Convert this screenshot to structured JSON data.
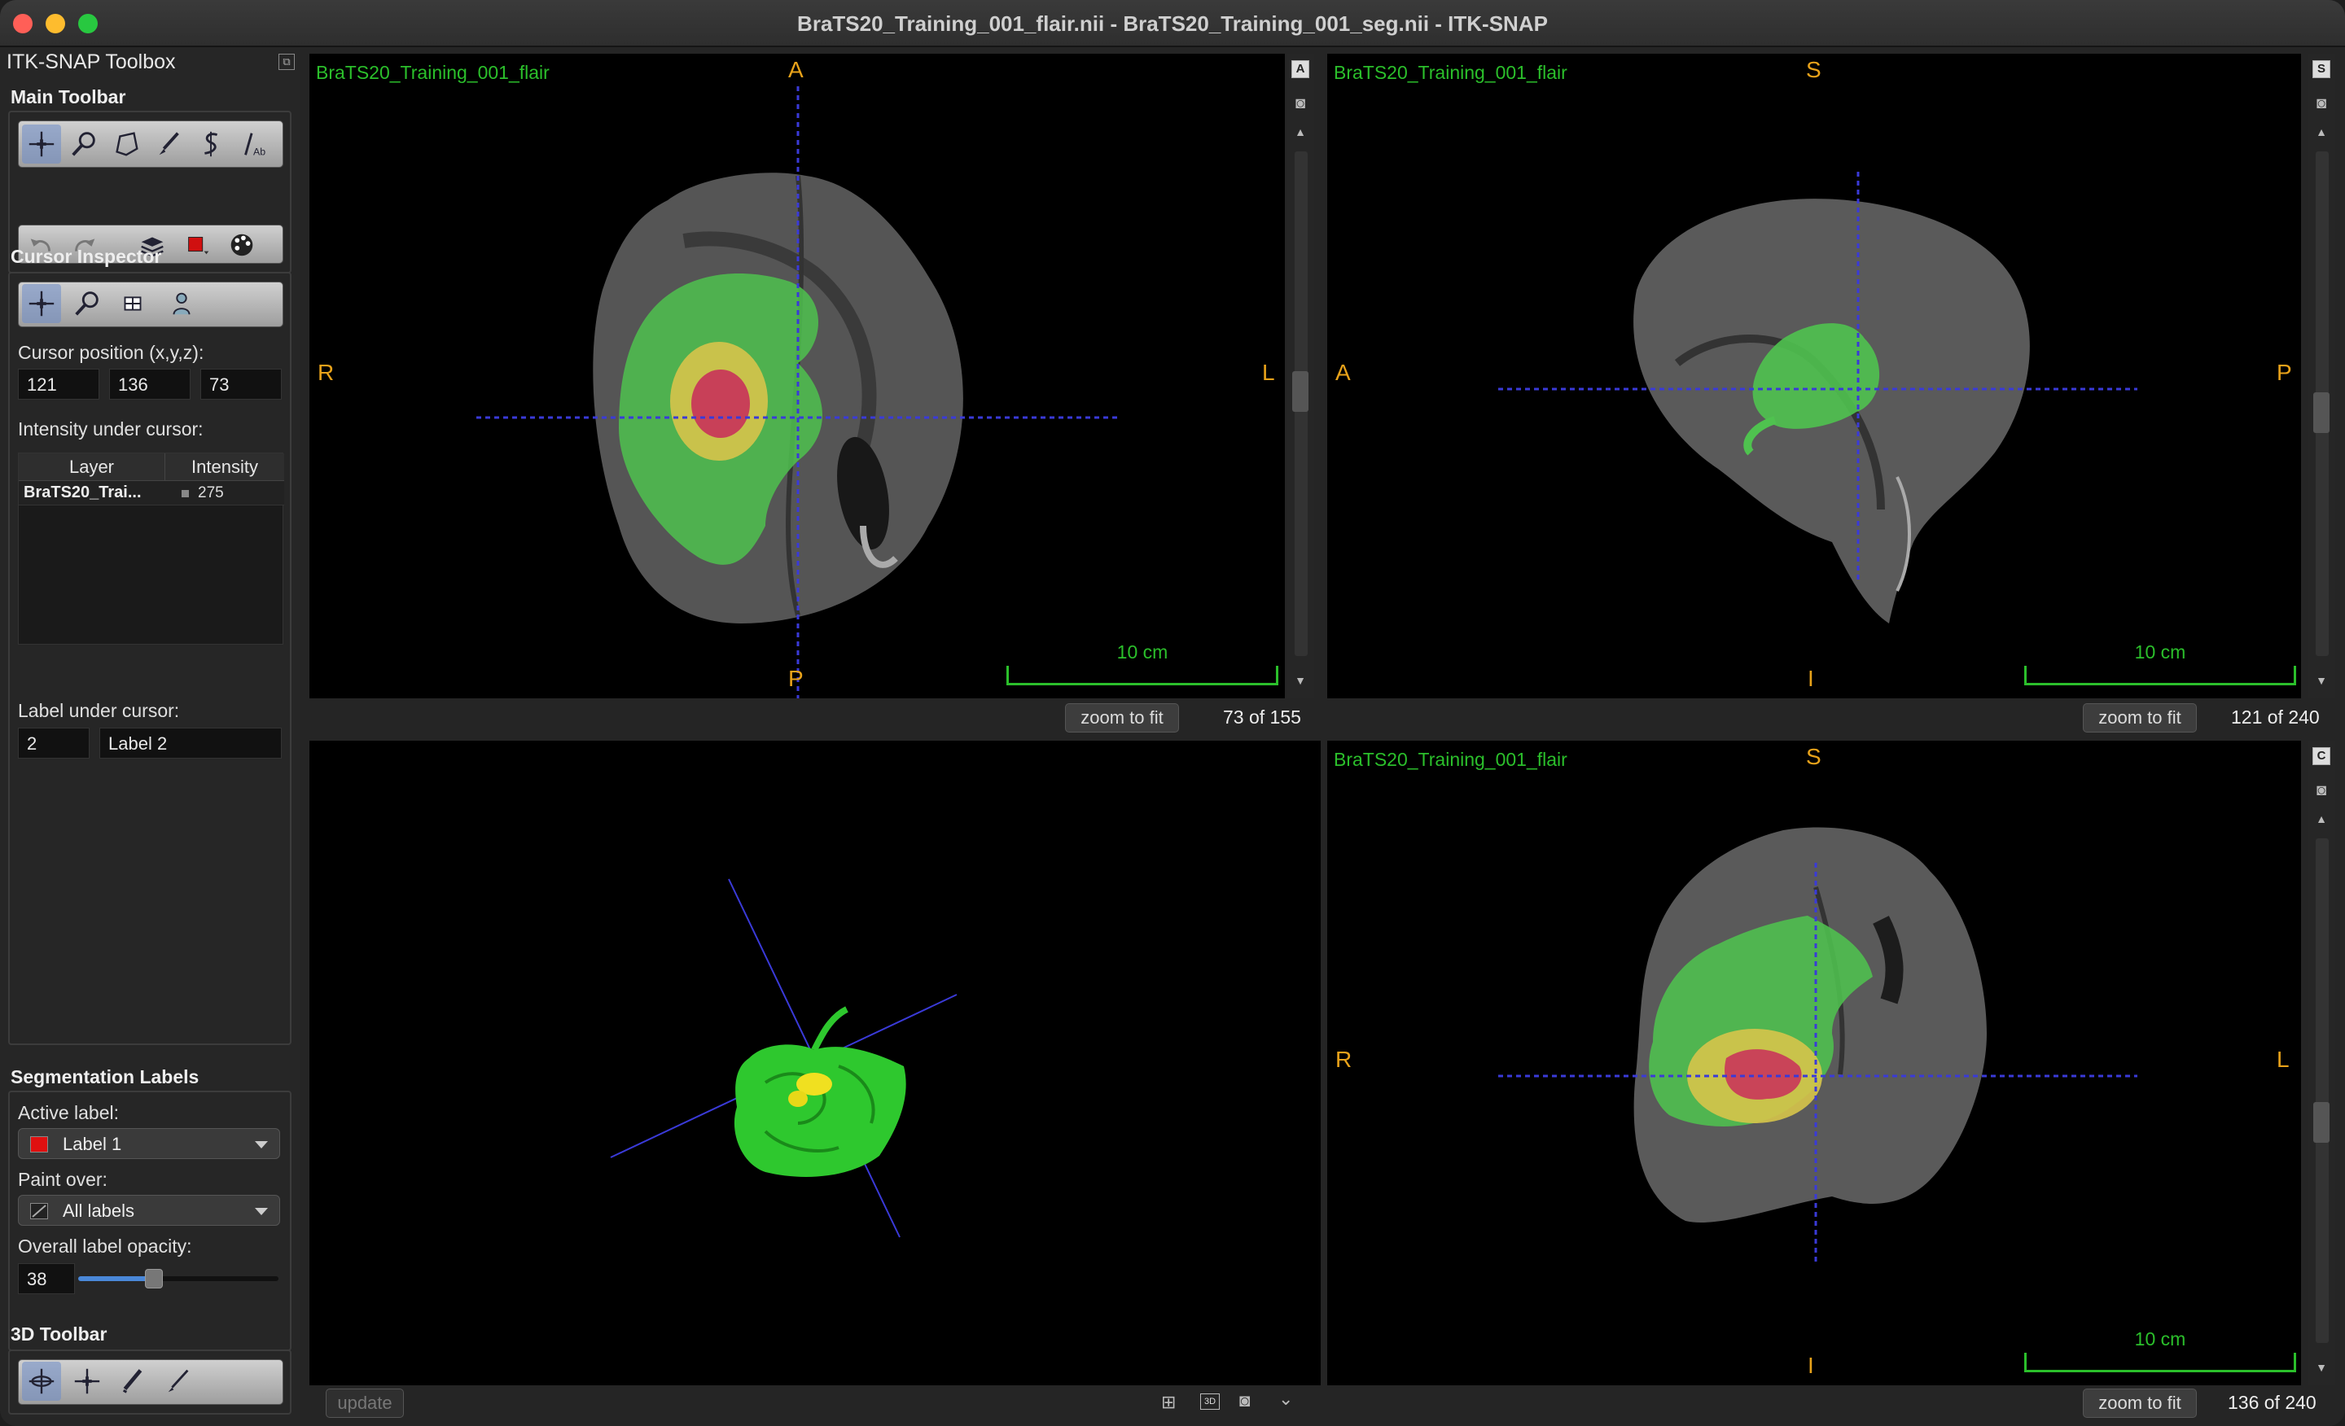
{
  "window": {
    "title": "BraTS20_Training_001_flair.nii - BraTS20_Training_001_seg.nii - ITK-SNAP"
  },
  "toolbox": {
    "title": "ITK-SNAP Toolbox",
    "main_toolbar": {
      "heading": "Main Toolbar",
      "row1": [
        "crosshair-tool",
        "zoom-tool",
        "polygon-tool",
        "paintbrush-tool",
        "snake-tool",
        "annotation-tool"
      ],
      "row2": [
        "undo",
        "redo",
        "layers",
        "label-color",
        "palette"
      ]
    },
    "cursor_inspector": {
      "heading": "Cursor Inspector",
      "position_label": "Cursor position (x,y,z):",
      "x": "121",
      "y": "136",
      "z": "73",
      "intensity_label": "Intensity under cursor:",
      "table_headers": [
        "Layer",
        "Intensity"
      ],
      "rows": [
        {
          "layer": "BraTS20_Trai...",
          "intensity": "275"
        }
      ],
      "label_under_cursor_label": "Label under cursor:",
      "label_id": "2",
      "label_name": "Label 2"
    },
    "segmentation_labels": {
      "heading": "Segmentation Labels",
      "active_label_label": "Active label:",
      "active_label": "Label 1",
      "active_label_color": "#e01010",
      "paint_over_label": "Paint over:",
      "paint_over": "All labels",
      "opacity_label": "Overall label opacity:",
      "opacity": "38",
      "opacity_fraction": 0.38
    },
    "toolbar_3d": {
      "heading": "3D Toolbar"
    }
  },
  "views": {
    "axial": {
      "name": "BraTS20_Training_001_flair",
      "orient_top": "A",
      "orient_bottom": "P",
      "orient_left": "R",
      "orient_right": "L",
      "scale": "10 cm",
      "zoom_button": "zoom to fit",
      "slice": "73 of 155",
      "corner_button": "A"
    },
    "sagittal": {
      "name": "BraTS20_Training_001_flair",
      "orient_top": "S",
      "orient_bottom": "I",
      "orient_left": "A",
      "orient_right": "P",
      "scale": "10 cm",
      "zoom_button": "zoom to fit",
      "slice": "121 of 240",
      "corner_button": "S"
    },
    "render3d": {
      "update_button": "update"
    },
    "coronal": {
      "name": "BraTS20_Training_001_flair",
      "orient_top": "S",
      "orient_bottom": "I",
      "orient_left": "R",
      "orient_right": "L",
      "scale": "10 cm",
      "zoom_button": "zoom to fit",
      "slice": "136 of 240",
      "corner_button": "C"
    }
  },
  "colors": {
    "edema": "#4fc24f",
    "enhancing": "#d6c44a",
    "necrotic": "#c8325a",
    "overlay_text": "#2bbf2b",
    "orientation": "#e8a21a",
    "crosshair": "#3a3ad8"
  }
}
